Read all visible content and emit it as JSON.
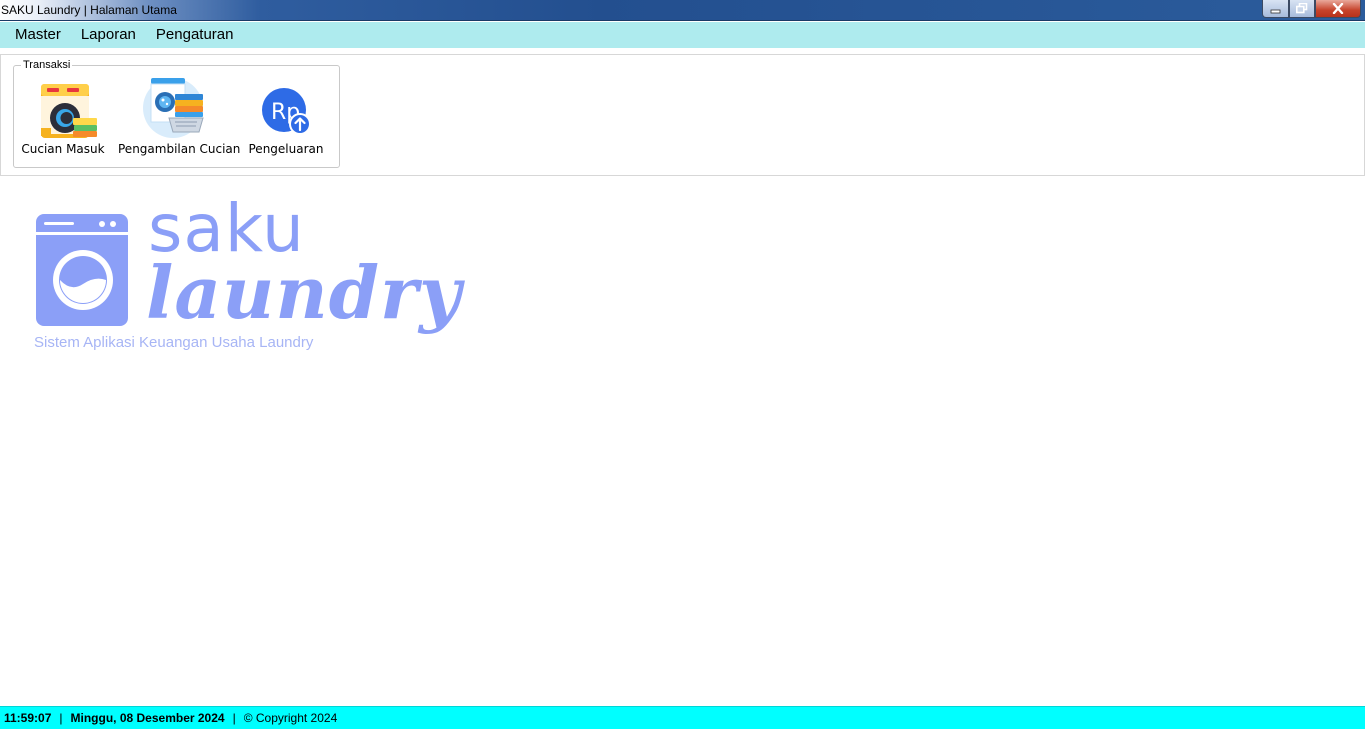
{
  "window": {
    "title": "SAKU Laundry | Halaman Utama"
  },
  "menu": [
    "Master",
    "Laporan",
    "Pengaturan"
  ],
  "transaksi": {
    "group_title": "Transaksi",
    "tools": [
      {
        "label": "Cucian Masuk",
        "icon": "washing-machine-icon"
      },
      {
        "label": "Pengambilan Cucian",
        "icon": "laundry-pickup-icon"
      },
      {
        "label": "Pengeluaran",
        "icon": "rupiah-expense-icon"
      }
    ]
  },
  "logo": {
    "line1": "saku",
    "line2": "laundry",
    "tagline": "Sistem Aplikasi Keuangan Usaha Laundry",
    "color": "#8b9ff7"
  },
  "status": {
    "time": "11:59:07",
    "separator": "|",
    "date": "Minggu, 08 Desember 2024",
    "copyright": "© Copyright 2024",
    "background": "#00ffff"
  }
}
